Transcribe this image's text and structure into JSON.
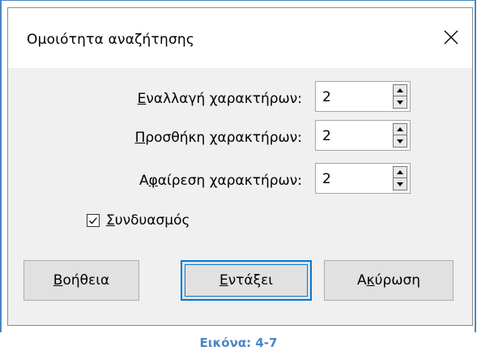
{
  "dialog": {
    "title": "Ομοιότητα αναζήτησης",
    "close_icon": "close-icon"
  },
  "fields": [
    {
      "label_mn": "Ε",
      "label_rest": "ναλλαγή χαρακτήρων:",
      "value": "2"
    },
    {
      "label_mn": "Π",
      "label_rest": "ροσθήκη χαρακτήρων:",
      "value": "2"
    },
    {
      "label_pre": "Α",
      "label_mn": "φ",
      "label_rest": "αίρεση χαρακτήρων:",
      "value": "2"
    }
  ],
  "checkbox": {
    "label_mn": "Σ",
    "label_rest": "υνδυασμός",
    "checked": true
  },
  "buttons": {
    "help": {
      "mn": "Β",
      "rest": "οήθεια"
    },
    "ok": {
      "mn": "Ε",
      "rest": "ντάξει"
    },
    "cancel": {
      "pre": "Α",
      "mn": "κ",
      "rest": "ύρωση"
    }
  },
  "caption": "Εικόνα: 4-7",
  "colors": {
    "accent": "#0078d7",
    "frame": "#4a86c5"
  }
}
